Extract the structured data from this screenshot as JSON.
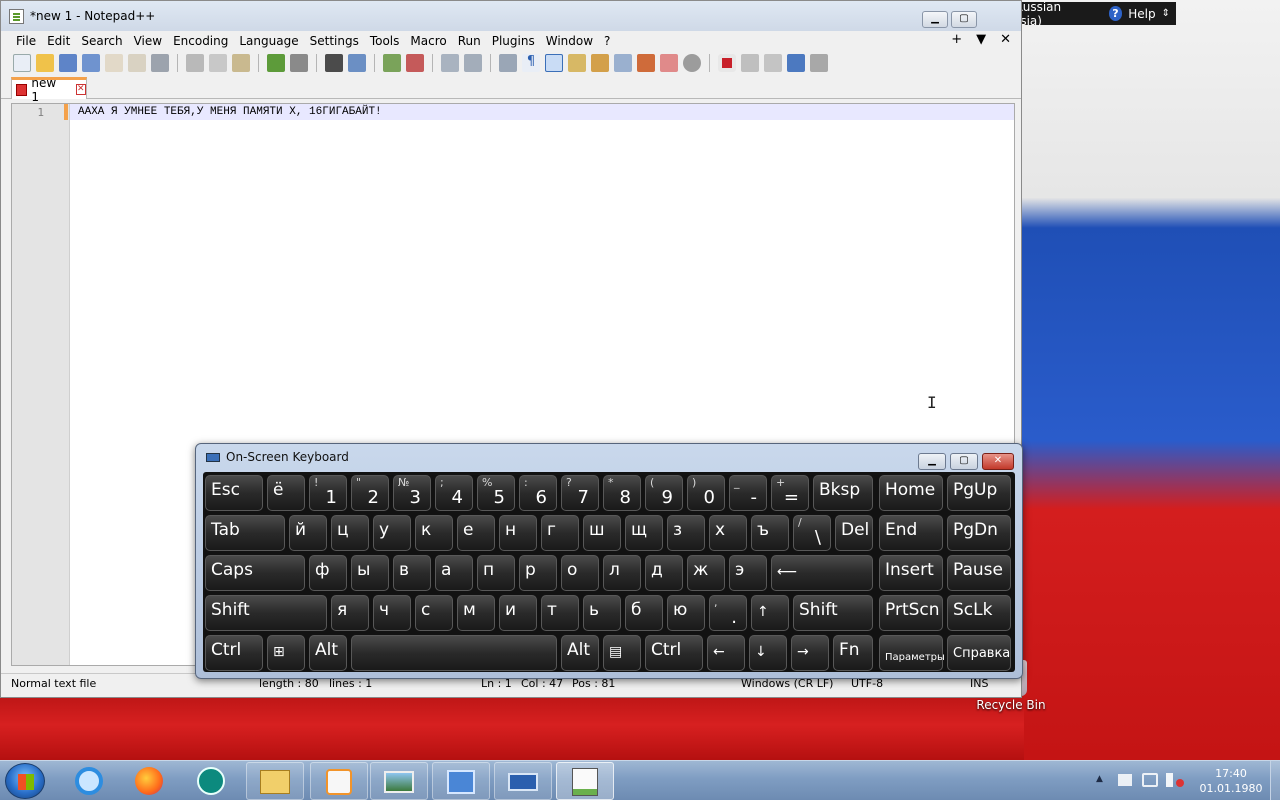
{
  "window": {
    "title": "*new 1 - Notepad++",
    "min": "▁",
    "max": "▢"
  },
  "menu": [
    "File",
    "Edit",
    "Search",
    "View",
    "Encoding",
    "Language",
    "Settings",
    "Tools",
    "Macro",
    "Run",
    "Plugins",
    "Window",
    "?"
  ],
  "menu_right": {
    "plus": "+",
    "down": "▼",
    "close": "✕"
  },
  "tab": {
    "label": "new 1",
    "close": "✕"
  },
  "editor": {
    "line_number": "1",
    "text": "ААХА Я УМНЕЕ ТЕБЯ,У МЕНЯ ПАМЯТИ Х, 16ГИГАБАЙТ!",
    "cursor": "I"
  },
  "status": {
    "file_type": "Normal text file",
    "length": "length : 80",
    "lines": "lines : 1",
    "ln": "Ln : 1",
    "col": "Col : 47",
    "pos": "Pos : 81",
    "eol": "Windows (CR LF)",
    "encoding": "UTF-8",
    "mode": "INS"
  },
  "langbar": {
    "language": "RU Russian (Russia)",
    "help": "Help",
    "help_icon": "?",
    "menu": "⇕"
  },
  "recycle_bin": {
    "label": "Recycle Bin"
  },
  "osk": {
    "title": "On-Screen Keyboard",
    "min": "▁",
    "max": "▢",
    "close": "✕",
    "keys": {
      "esc": "Esc",
      "yo": "ё",
      "n1s": "!",
      "n1": "1",
      "n2s": "\"",
      "n2": "2",
      "n3s": "№",
      "n3": "3",
      "n4s": ";",
      "n4": "4",
      "n5s": "%",
      "n5": "5",
      "n6s": ":",
      "n6": "6",
      "n7s": "?",
      "n7": "7",
      "n8s": "*",
      "n8": "8",
      "n9s": "(",
      "n9": "9",
      "n0s": ")",
      "n0": "0",
      "minus_s": "_",
      "minus": "-",
      "eq_s": "+",
      "eq": "=",
      "bksp": "Bksp",
      "home": "Home",
      "pgup": "PgUp",
      "tab": "Tab",
      "y1": "й",
      "ts": "ц",
      "u": "у",
      "k": "к",
      "ye": "е",
      "n": "н",
      "g": "г",
      "sh": "ш",
      "shch": "щ",
      "z": "з",
      "kh": "х",
      "hard": "ъ",
      "bslash_s": "/",
      "bslash": "\\",
      "del": "Del",
      "end": "End",
      "pgdn": "PgDn",
      "caps": "Caps",
      "f": "ф",
      "yy": "ы",
      "v": "в",
      "a": "а",
      "p": "п",
      "r": "р",
      "o": "о",
      "l": "л",
      "d": "д",
      "zh": "ж",
      "e": "э",
      "enter": "⟵",
      "insert": "Insert",
      "pause": "Pause",
      "shift_l": "Shift",
      "ya": "я",
      "ch": "ч",
      "s": "с",
      "m": "м",
      "i": "и",
      "t": "т",
      "soft": "ь",
      "b": "б",
      "yu": "ю",
      "dot_s": ",",
      "dot": ".",
      "up": "↑",
      "shift_r": "Shift",
      "prtscn": "PrtScn",
      "sclk": "ScLk",
      "ctrl_l": "Ctrl",
      "win": "⊞",
      "alt_l": "Alt",
      "alt_r": "Alt",
      "menu": "▤",
      "ctrl_r": "Ctrl",
      "left": "←",
      "down": "↓",
      "right": "→",
      "fn": "Fn",
      "options": "Параметры",
      "help": "Справка"
    }
  },
  "taskbar": {
    "time": "17:40",
    "date": "01.01.1980",
    "show_hidden": "▲"
  }
}
